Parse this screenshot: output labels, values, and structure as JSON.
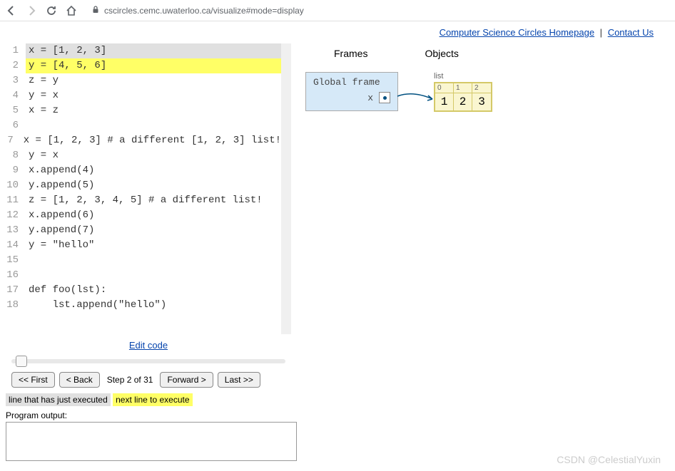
{
  "browser": {
    "url": "cscircles.cemc.uwaterloo.ca/visualize#mode=display"
  },
  "header": {
    "homepage": "Computer Science Circles Homepage",
    "contact": "Contact Us"
  },
  "code": {
    "lines": [
      {
        "n": 1,
        "text": "x = [1, 2, 3]",
        "state": "executed"
      },
      {
        "n": 2,
        "text": "y = [4, 5, 6]",
        "state": "next"
      },
      {
        "n": 3,
        "text": "z = y",
        "state": ""
      },
      {
        "n": 4,
        "text": "y = x",
        "state": ""
      },
      {
        "n": 5,
        "text": "x = z",
        "state": ""
      },
      {
        "n": 6,
        "text": "",
        "state": ""
      },
      {
        "n": 7,
        "text": "x = [1, 2, 3] # a different [1, 2, 3] list!",
        "state": ""
      },
      {
        "n": 8,
        "text": "y = x",
        "state": ""
      },
      {
        "n": 9,
        "text": "x.append(4)",
        "state": ""
      },
      {
        "n": 10,
        "text": "y.append(5)",
        "state": ""
      },
      {
        "n": 11,
        "text": "z = [1, 2, 3, 4, 5] # a different list!",
        "state": ""
      },
      {
        "n": 12,
        "text": "x.append(6)",
        "state": ""
      },
      {
        "n": 13,
        "text": "y.append(7)",
        "state": ""
      },
      {
        "n": 14,
        "text": "y = \"hello\"",
        "state": ""
      },
      {
        "n": 15,
        "text": "",
        "state": ""
      },
      {
        "n": 16,
        "text": "",
        "state": ""
      },
      {
        "n": 17,
        "text": "def foo(lst):",
        "state": ""
      },
      {
        "n": 18,
        "text": "    lst.append(\"hello\")",
        "state": ""
      }
    ],
    "edit_link": "Edit code"
  },
  "controls": {
    "first": "<< First",
    "back": "< Back",
    "step": "Step 2 of 31",
    "forward": "Forward >",
    "last": "Last >>"
  },
  "legend": {
    "executed": "line that has just executed",
    "next": "next line to execute"
  },
  "output": {
    "label": "Program output:"
  },
  "viz": {
    "frames_header": "Frames",
    "objects_header": "Objects",
    "global_frame": {
      "title": "Global frame",
      "vars": [
        {
          "name": "x"
        }
      ]
    },
    "objects": [
      {
        "type": "list",
        "label": "list",
        "items": [
          {
            "idx": "0",
            "val": "1"
          },
          {
            "idx": "1",
            "val": "2"
          },
          {
            "idx": "2",
            "val": "3"
          }
        ]
      }
    ]
  },
  "watermark": "CSDN @CelestialYuxin"
}
